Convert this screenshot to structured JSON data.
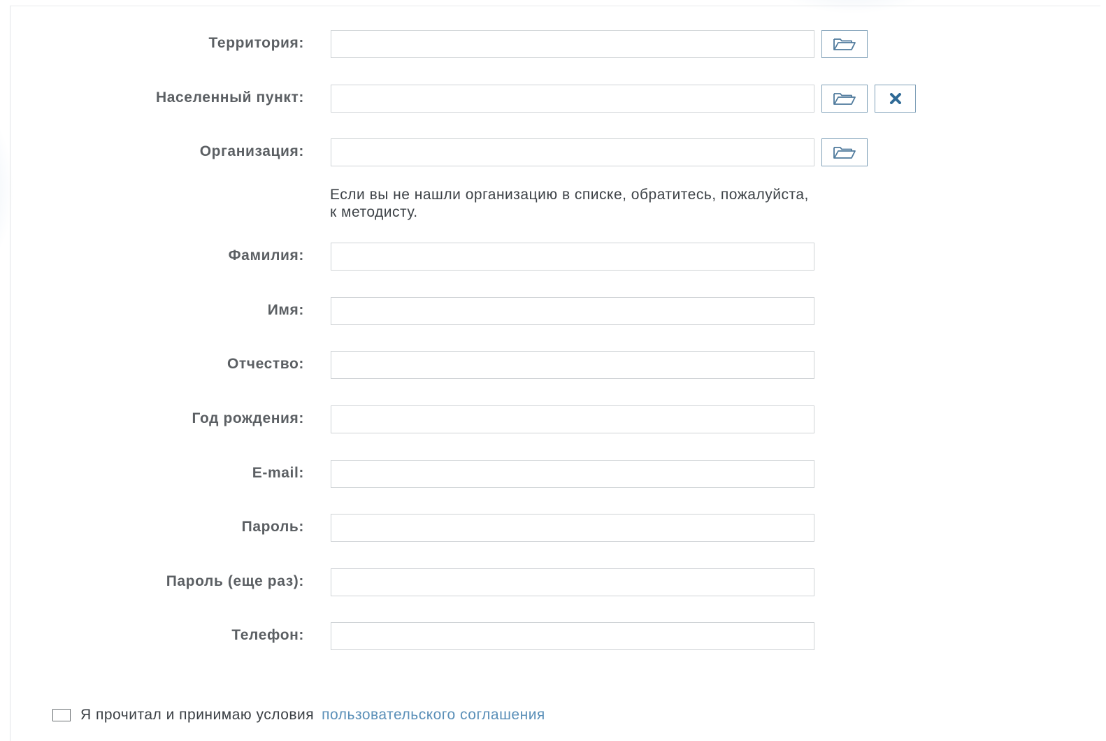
{
  "form": {
    "territory": {
      "label": "Территория:",
      "value": "",
      "placeholder": ""
    },
    "locality": {
      "label": "Населенный пункт:",
      "value": "",
      "placeholder": ""
    },
    "organization": {
      "label": "Организация:",
      "value": "",
      "placeholder": ""
    },
    "organization_hint": "Если вы не нашли организацию в списке, обратитесь, пожалуйста, к методисту.",
    "last_name": {
      "label": "Фамилия:",
      "value": "",
      "placeholder": ""
    },
    "first_name": {
      "label": "Имя:",
      "value": "",
      "placeholder": ""
    },
    "middle_name": {
      "label": "Отчество:",
      "value": "",
      "placeholder": ""
    },
    "birth_year": {
      "label": "Год рождения:",
      "value": "",
      "placeholder": ""
    },
    "email": {
      "label": "E-mail:",
      "value": "",
      "placeholder": ""
    },
    "password": {
      "label": "Пароль:",
      "value": "",
      "placeholder": ""
    },
    "password_repeat": {
      "label": "Пароль (еще раз):",
      "value": "",
      "placeholder": ""
    },
    "phone": {
      "label": "Телефон:",
      "value": "",
      "placeholder": ""
    }
  },
  "consent": {
    "checked": false,
    "text": "Я прочитал и принимаю условия",
    "link_text": "пользовательского соглашения"
  },
  "icons": {
    "picker": "folder-open-icon",
    "clear": "close-icon"
  },
  "colors": {
    "label_text": "#5b5f63",
    "input_border": "#cfd3d6",
    "icon_button_border": "#7fa0b8",
    "icon_color": "#4f7a9c",
    "clear_icon_color": "#2f6a96",
    "link_color": "#5a8fb8"
  }
}
